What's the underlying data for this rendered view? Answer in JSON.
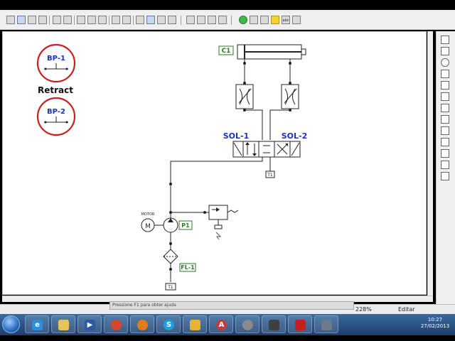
{
  "toolbar": {
    "buttons": [
      "new",
      "open",
      "save",
      "save-as",
      "print",
      "print-preview",
      "cut",
      "copy",
      "paste",
      "delete",
      "undo",
      "redo",
      "select",
      "rotate",
      "component",
      "text",
      "insert",
      "zoom-in",
      "zoom-out",
      "zoom-fit",
      "zoom-window",
      "simulate",
      "step",
      "pause",
      "stop",
      "restart"
    ],
    "label_abc": "abc"
  },
  "components": {
    "bp1": "BP-1",
    "bp2": "BP-2",
    "retract": "Retract",
    "c1": "C1",
    "sol1": "SOL-1",
    "sol2": "SOL-2",
    "t1_top": "T1",
    "t1_bottom": "T1",
    "motor": "MOTOR",
    "p1": "P1",
    "fl1": "FL-1"
  },
  "statusbar": {
    "tooltip": "Pressione F1 para obter ajuda",
    "zoom": "228%",
    "mode": "Editar"
  },
  "taskbar": {
    "apps": [
      "explorer",
      "internet-explorer",
      "file-manager",
      "media-player",
      "chrome",
      "firefox",
      "skype",
      "outlook",
      "automation-studio",
      "settings",
      "media",
      "pdf-reader",
      "tools"
    ],
    "time": "10:27",
    "date": "27/02/2013"
  },
  "colors": {
    "accent_red": "#c82020",
    "label_blue": "#1c32b8",
    "label_green": "#2a7a2a",
    "taskbar": "#2b4f82"
  }
}
